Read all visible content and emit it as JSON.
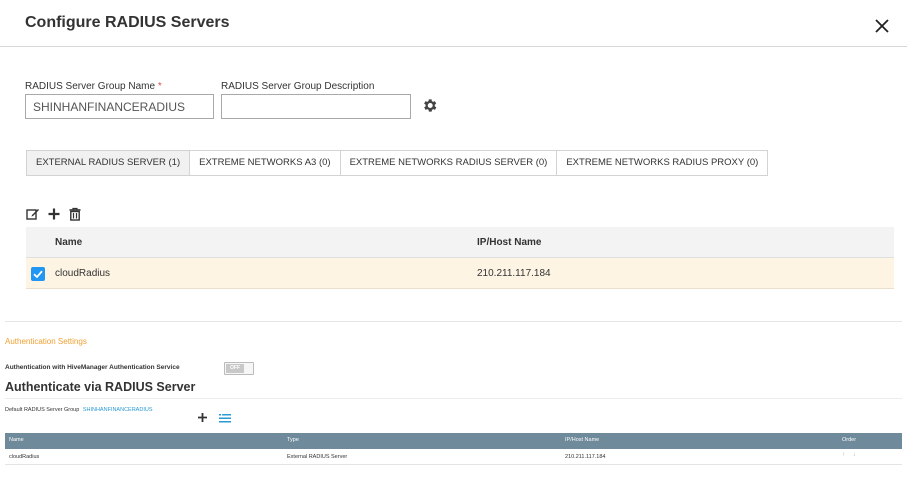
{
  "modal": {
    "title": "Configure RADIUS Servers"
  },
  "form": {
    "group_name_label": "RADIUS Server Group Name",
    "group_name_required": "*",
    "group_name_value": "SHINHANFINANCERADIUS",
    "group_desc_label": "RADIUS Server Group Description",
    "group_desc_value": ""
  },
  "tabs": [
    {
      "label": "EXTERNAL RADIUS SERVER  (1)",
      "active": true
    },
    {
      "label": "EXTREME NETWORKS A3  (0)",
      "active": false
    },
    {
      "label": "EXTREME NETWORKS RADIUS SERVER  (0)",
      "active": false
    },
    {
      "label": "EXTREME NETWORKS RADIUS PROXY  (0)",
      "active": false
    }
  ],
  "toolbar": {
    "icons": [
      "edit-icon",
      "add-icon",
      "delete-icon"
    ]
  },
  "server_table": {
    "columns": [
      "Name",
      "IP/Host Name"
    ],
    "rows": [
      {
        "checked": true,
        "name": "cloudRadius",
        "host": "210.211.117.184"
      }
    ]
  },
  "auth": {
    "settings_title": "Authentication Settings",
    "service_label": "Authentication with HiveManager Authentication Service",
    "toggle_label": "OFF",
    "via_title": "Authenticate via RADIUS Server",
    "default_group_label": "Default RADIUS Server Group",
    "default_group_value": "SHINHANFINANCERADIUS"
  },
  "auth_table": {
    "columns": [
      "Name",
      "Type",
      "IP/Host Name",
      "Order"
    ],
    "rows": [
      {
        "name": "cloudRadius",
        "type": "External RADIUS Server",
        "host": "210.211.117.184",
        "order": "↑ ↓"
      }
    ]
  },
  "colors": {
    "accent_blue": "#2196f3",
    "link_blue": "#2a9bd6",
    "section_orange": "#f0a030",
    "table_header": "#6e8a9b",
    "selected_row": "#fdf4e4"
  }
}
